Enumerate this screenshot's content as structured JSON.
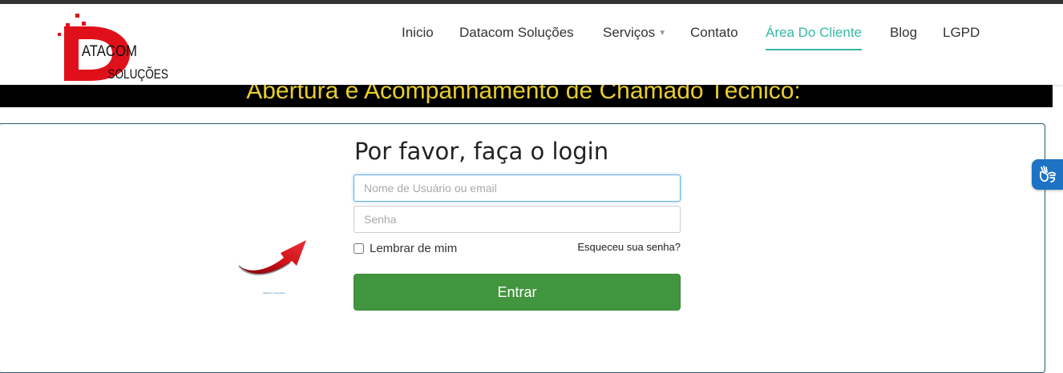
{
  "colors": {
    "accent": "#35b9a5",
    "banner_bg": "#000000",
    "banner_text": "#e8cf2d",
    "button": "#42953f",
    "logo_red": "#e0101a"
  },
  "logo": {
    "line1": "ATACOM",
    "line2": "SOLUÇÕES",
    "icon": "datacom-logo-icon"
  },
  "nav": {
    "items": [
      {
        "label": "Inicio",
        "active": false
      },
      {
        "label": "Datacom Soluções",
        "active": false
      },
      {
        "label": "Serviços",
        "active": false,
        "has_dropdown": true
      },
      {
        "label": "Contato",
        "active": false
      },
      {
        "label": "Área Do Cliente",
        "active": true
      },
      {
        "label": "Blog",
        "active": false
      },
      {
        "label": "LGPD",
        "active": false
      }
    ]
  },
  "banner": {
    "text": "Abertura e Acompanhamento de Chamado Técnico:"
  },
  "login": {
    "title": "Por favor, faça o login",
    "username_placeholder": "Nome de Usuário ou email",
    "password_placeholder": "Senha",
    "remember_label": "Lembrar de mim",
    "forgot_label": "Esqueceu sua senha?",
    "submit_label": "Entrar"
  },
  "decor": {
    "arrow_icon": "red-arrow-icon",
    "small_text": "datacom soluções"
  },
  "accessibility": {
    "icon": "sign-language-hands-icon"
  }
}
